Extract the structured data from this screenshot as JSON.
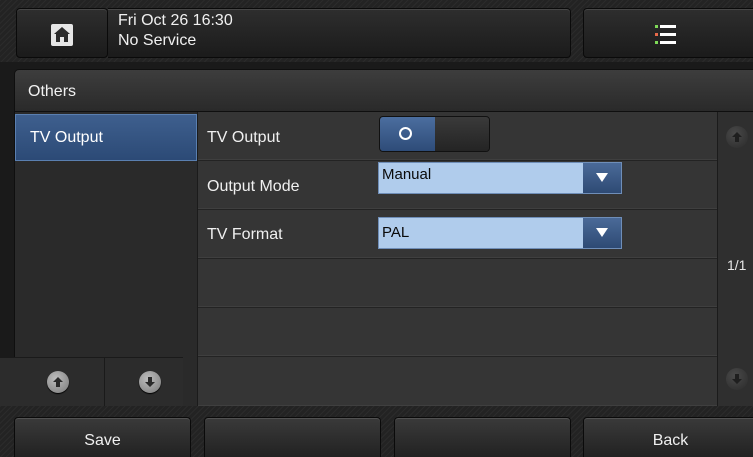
{
  "status_bar": {
    "date_time": "Fri Oct 26 16:30",
    "service": "No Service"
  },
  "section": {
    "title": "Others"
  },
  "left_menu": {
    "items": [
      {
        "label": "TV Output",
        "selected": true
      }
    ]
  },
  "settings": {
    "rows": [
      {
        "label": "TV Output",
        "control": "toggle",
        "on": true
      },
      {
        "label": "Output Mode",
        "control": "dropdown",
        "value": "Manual"
      },
      {
        "label": "TV Format",
        "control": "dropdown",
        "value": "PAL"
      }
    ]
  },
  "pager": {
    "text": "1/1"
  },
  "softkeys": {
    "save": "Save",
    "key2": "",
    "key3": "",
    "back": "Back"
  },
  "colors": {
    "accent_blue": "#3e5f8e",
    "dropdown_fill": "#b0ccec",
    "background": "#1a1a1a"
  },
  "icons": {
    "home": "home-icon",
    "menu": "menu-list-icon",
    "up": "arrow-up-icon",
    "down": "arrow-down-icon",
    "dropdown": "dropdown-arrow-icon"
  }
}
